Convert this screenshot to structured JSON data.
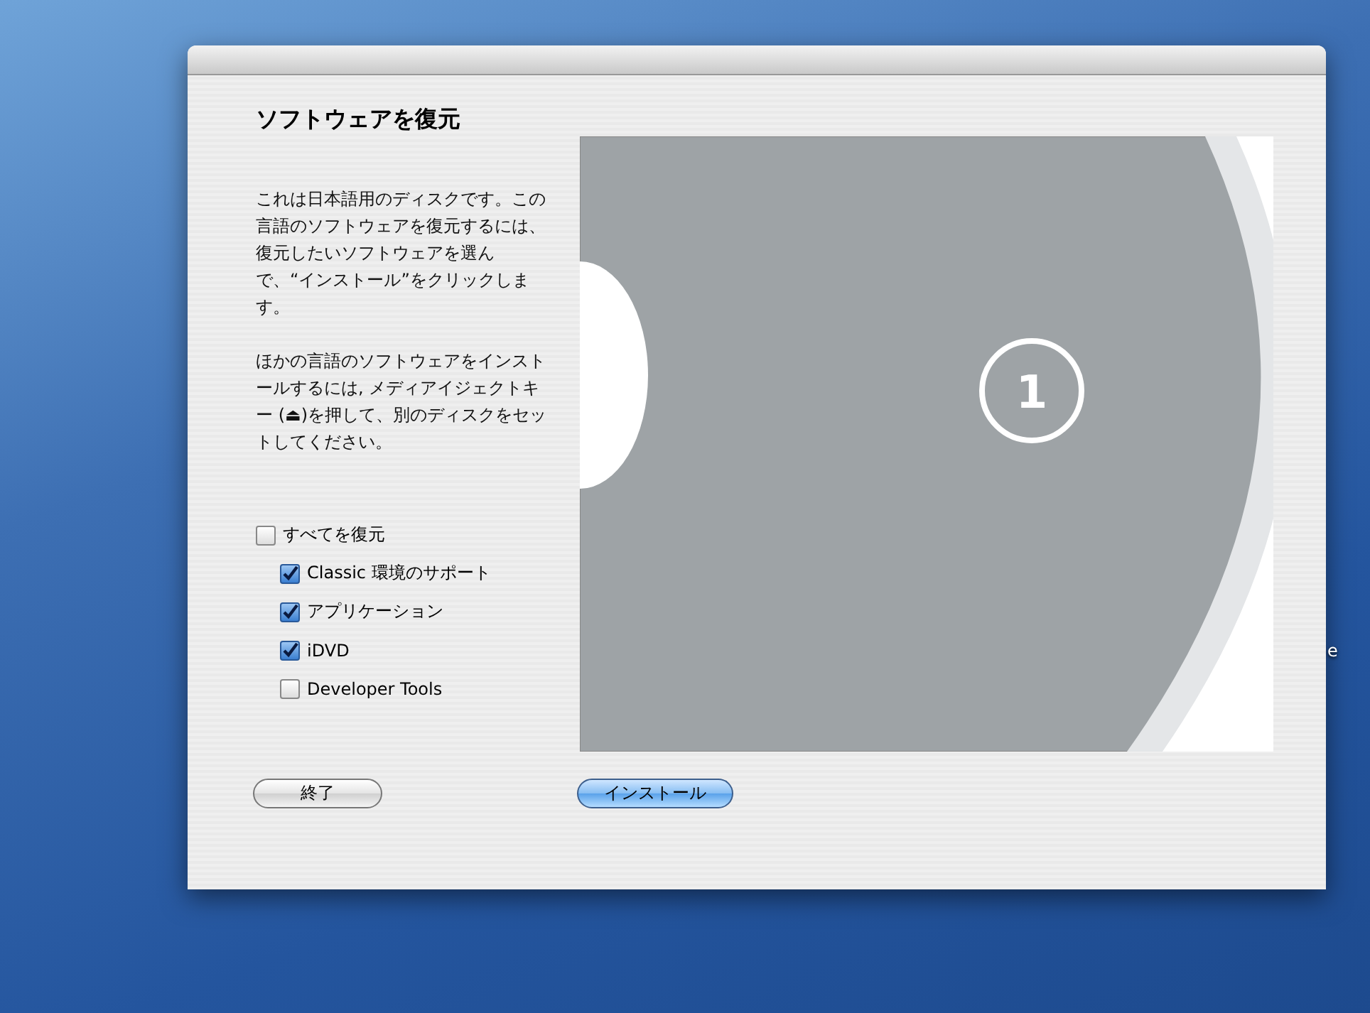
{
  "window": {
    "title": "ソフトウェアを復元"
  },
  "description": [
    "これは日本語用のディスクです。この言語のソフトウェアを復元するには、復元したいソフトウェアを選んで、“インストール”をクリックします。",
    "ほかの言語のソフトウェアをインストールするには, メディアイジェクトキー (⏏)を押して、別のディスクをセットしてください。"
  ],
  "options": {
    "label": "すべてを復元",
    "checked": false,
    "children": [
      {
        "label": "Classic 環境のサポート",
        "checked": true
      },
      {
        "label": "アプリケーション",
        "checked": true
      },
      {
        "label": "iDVD",
        "checked": true
      },
      {
        "label": "Developer Tools",
        "checked": false
      }
    ]
  },
  "disc": {
    "number": "1"
  },
  "buttons": [
    {
      "label": "終了",
      "kind": "plain"
    },
    {
      "label": "インストール",
      "kind": "default"
    }
  ],
  "desktop": {
    "label": "e"
  }
}
